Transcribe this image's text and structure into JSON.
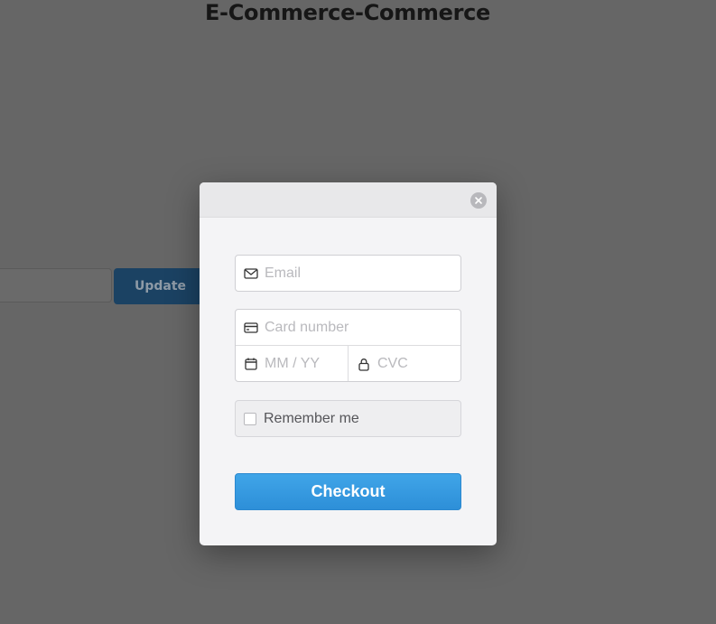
{
  "page": {
    "title": "E-Commerce-Commerce",
    "update_label": "Update"
  },
  "modal": {
    "close_icon": "close-icon",
    "email": {
      "placeholder": "Email",
      "icon": "envelope-icon"
    },
    "card_number": {
      "placeholder": "Card number",
      "icon": "credit-card-icon"
    },
    "expiry": {
      "placeholder": "MM / YY",
      "icon": "calendar-icon"
    },
    "cvc": {
      "placeholder": "CVC",
      "icon": "lock-icon"
    },
    "remember_label": "Remember me",
    "checkout_label": "Checkout"
  },
  "colors": {
    "overlay": "#666666",
    "checkout_button": "#3a9de3",
    "update_button": "#1b4263"
  }
}
